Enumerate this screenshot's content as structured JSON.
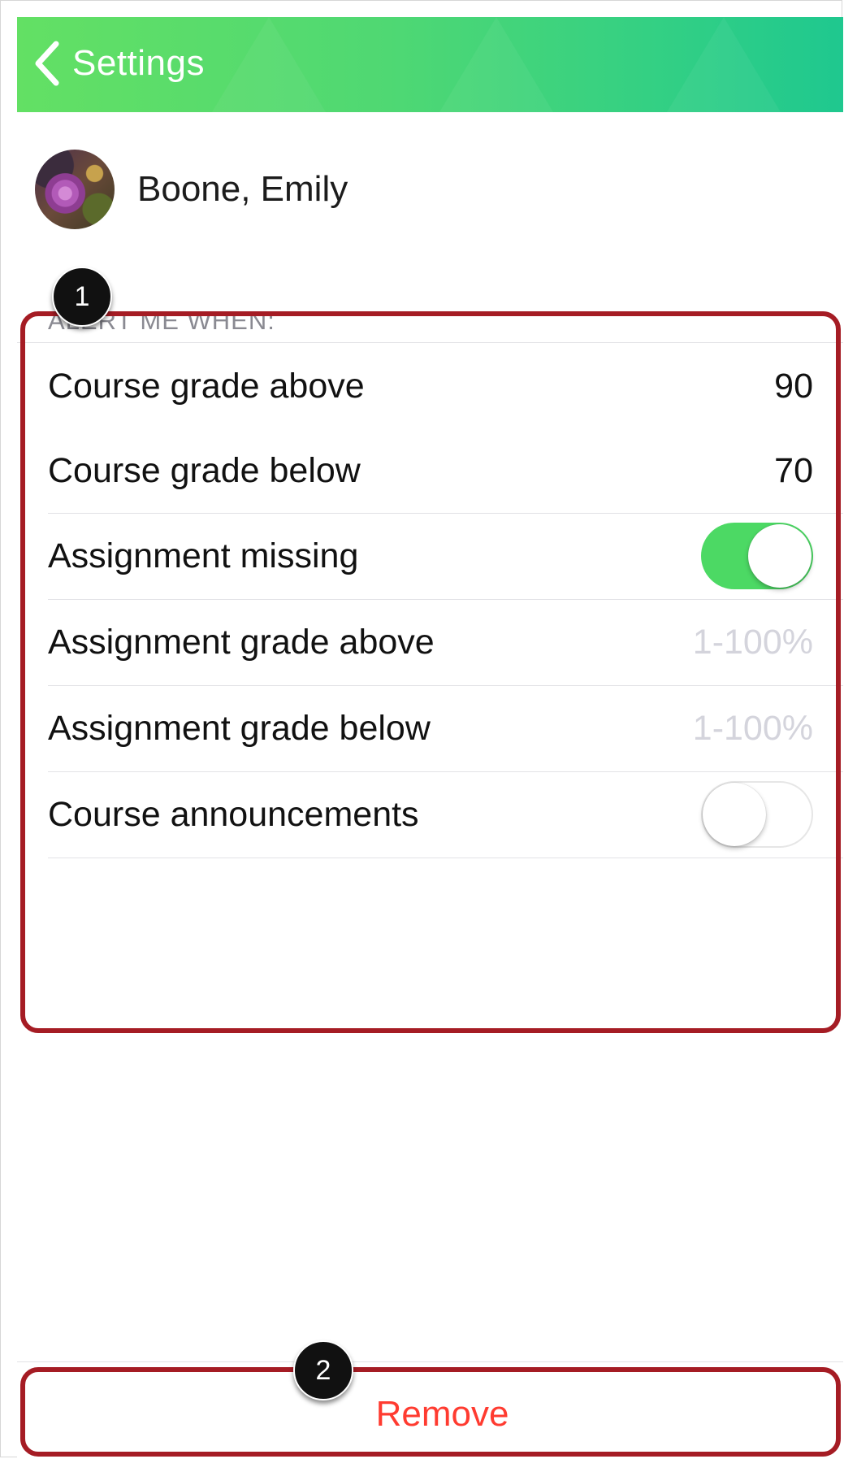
{
  "navbar": {
    "back_label": "Settings"
  },
  "profile": {
    "name": "Boone, Emily"
  },
  "alerts": {
    "header": "ALERT ME WHEN:",
    "course_grade_above": {
      "label": "Course grade above",
      "value": "90"
    },
    "course_grade_below": {
      "label": "Course grade below",
      "value": "70"
    },
    "assignment_missing": {
      "label": "Assignment missing",
      "enabled": true
    },
    "assignment_grade_above": {
      "label": "Assignment grade above",
      "placeholder": "1-100%"
    },
    "assignment_grade_below": {
      "label": "Assignment grade below",
      "placeholder": "1-100%"
    },
    "course_announcements": {
      "label": "Course announcements",
      "enabled": false
    }
  },
  "remove_button": {
    "label": "Remove"
  },
  "callouts": {
    "one": "1",
    "two": "2"
  },
  "colors": {
    "navbar_start": "#63e064",
    "navbar_end": "#1fc88f",
    "toggle_on": "#4cd964",
    "destructive": "#ff3b30",
    "highlight_border": "#a51c24"
  }
}
